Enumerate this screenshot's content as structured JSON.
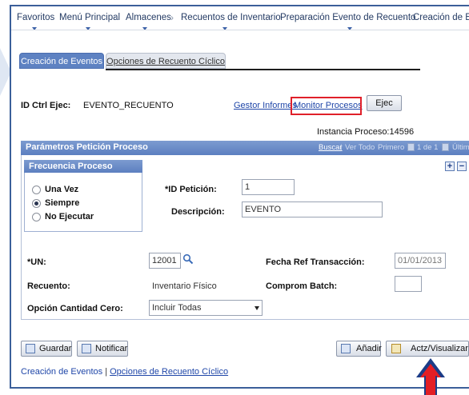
{
  "breadcrumb": {
    "items": [
      "Favoritos",
      "Menú Principal",
      "Almacenes",
      "Recuentos de Inventario",
      "Preparación Evento de Recuento",
      "Creación de Eventos"
    ],
    "separator": "›"
  },
  "tabs": {
    "active": "Creación de Eventos",
    "inactive": "Opciones de Recuento Cíclico"
  },
  "header": {
    "run_control_label": "ID Ctrl Ejec:",
    "run_control_value": "EVENTO_RECUENTO",
    "report_manager_link": "Gestor Informes",
    "process_monitor_link": "Monitor Procesos",
    "run_button": "Ejec",
    "process_instance": "Instancia Proceso:14596"
  },
  "params": {
    "section_title": "Parámetros Petición Proceso",
    "pager": {
      "find": "Buscar",
      "sep": "|",
      "view_all": "Ver Todo",
      "first": "Primero",
      "range": "1 de 1",
      "last": "Último"
    },
    "frequency": {
      "title": "Frecuencia Proceso",
      "options": [
        "Una Vez",
        "Siempre",
        "No Ejecutar"
      ],
      "selected": "Siempre"
    },
    "request_id_label": "*ID Petición:",
    "request_id_value": "1",
    "description_label": "Descripción:",
    "description_value": "EVENTO",
    "unit_label": "*UN:",
    "unit_value": "12001",
    "txn_date_label": "Fecha Ref Transacción:",
    "txn_date_value": "01/01/2013",
    "count_label": "Recuento:",
    "count_value": "Inventario Físico",
    "commit_batch_label": "Comprom Batch:",
    "commit_batch_value": "",
    "zero_qty_label": "Opción Cantidad Cero:",
    "zero_qty_value": "Incluir Todas"
  },
  "toolbar": {
    "save": "Guardar",
    "notify": "Notificar",
    "add": "Añadir",
    "update_display": "Actz/Visualizar"
  },
  "footer_links": {
    "current": "Creación de Eventos",
    "sep": "|",
    "other": "Opciones de Recuento Cíclico"
  },
  "colors": {
    "accent_blue": "#5e82c2",
    "highlight_red": "#e0202a",
    "arrow_blue": "#1b3c87"
  }
}
